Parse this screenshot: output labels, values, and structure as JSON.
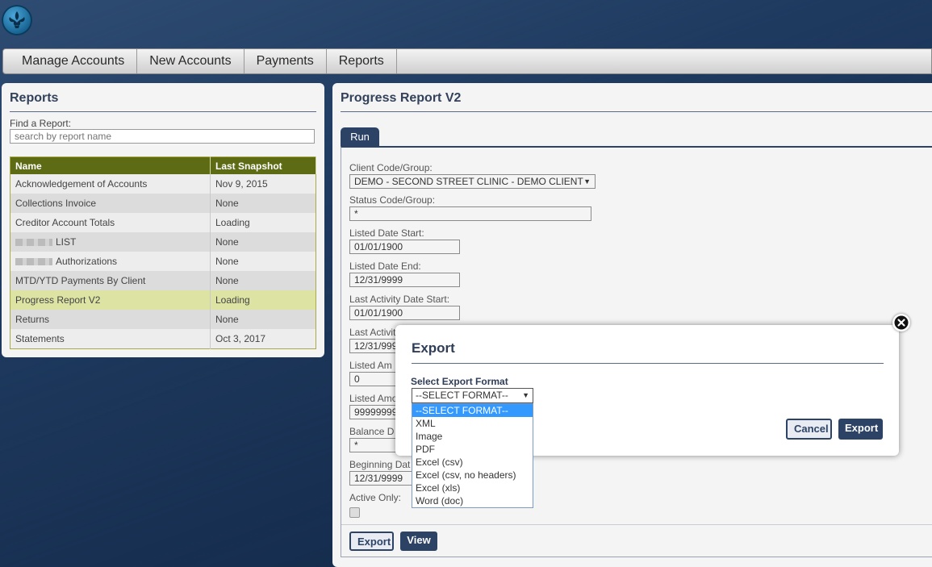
{
  "nav": {
    "items": [
      "Manage Accounts",
      "New Accounts",
      "Payments",
      "Reports"
    ]
  },
  "left": {
    "title": "Reports",
    "find_label": "Find a Report:",
    "find_placeholder": "search by report name",
    "columns": [
      "Name",
      "Last Snapshot"
    ],
    "rows": [
      {
        "name": "Acknowledgement of Accounts",
        "snapshot": "Nov 9, 2015"
      },
      {
        "name": "Collections Invoice",
        "snapshot": "None"
      },
      {
        "name": "Creditor Account Totals",
        "snapshot": "Loading"
      },
      {
        "name": "LIST",
        "snapshot": "None"
      },
      {
        "name": "Authorizations",
        "snapshot": "None"
      },
      {
        "name": "MTD/YTD Payments By Client",
        "snapshot": "None"
      },
      {
        "name": "Progress Report V2",
        "snapshot": "Loading"
      },
      {
        "name": "Returns",
        "snapshot": "None"
      },
      {
        "name": "Statements",
        "snapshot": "Oct 3, 2017"
      }
    ]
  },
  "right": {
    "title": "Progress Report V2",
    "tab": "Run",
    "fields": {
      "client_label": "Client Code/Group:",
      "client_value": "DEMO - SECOND STREET CLINIC - DEMO CLIENT",
      "status_label": "Status Code/Group:",
      "status_value": "*",
      "lds_label": "Listed Date Start:",
      "lds_value": "01/01/1900",
      "lde_label": "Listed Date End:",
      "lde_value": "12/31/9999",
      "lads_label": "Last Activity Date Start:",
      "lads_value": "01/01/1900",
      "lade_label": "Last Activit",
      "lade_value": "12/31/999",
      "lam1_label": "Listed Am",
      "lam1_value": "0",
      "lam2_label": "Listed Amo",
      "lam2_value": "99999999",
      "bal_label": "Balance D",
      "bal_value": "*",
      "beg_label": "Beginning Dat",
      "beg_value": "12/31/9999",
      "active_label": "Active Only:"
    },
    "export_button": "Export",
    "view_button": "View"
  },
  "modal": {
    "title": "Export",
    "format_label": "Select Export Format",
    "selected": "--SELECT FORMAT--",
    "options": [
      "--SELECT FORMAT--",
      "XML",
      "Image",
      "PDF",
      "Excel (csv)",
      "Excel (csv, no headers)",
      "Excel (xls)",
      "Word (doc)"
    ],
    "cancel": "Cancel",
    "export": "Export"
  }
}
